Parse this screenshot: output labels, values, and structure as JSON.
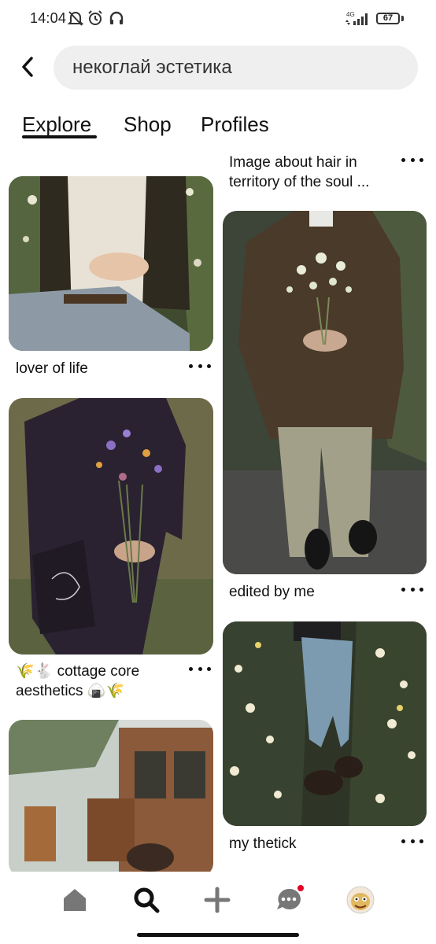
{
  "status": {
    "time": "14:04",
    "network": "4G",
    "battery": "67"
  },
  "search": {
    "query": "некоглай эстетика"
  },
  "tabs": [
    "Explore",
    "Shop",
    "Profiles"
  ],
  "pins": {
    "left": [
      {
        "title": "lover of life"
      },
      {
        "title": "🌾🐇 cottage core aesthetics 🍙🌾",
        "title_line1": "🌾🐇 cottage core",
        "title_line2": "aesthetics 🍙🌾"
      },
      {
        "title": ""
      }
    ],
    "right": [
      {
        "title_line1": "Image about hair in",
        "title_line2": "territory of the soul ..."
      },
      {
        "title": "edited by me"
      },
      {
        "title": "my thetick"
      }
    ]
  },
  "nav": {
    "items": [
      "home-icon",
      "search-icon",
      "add-icon",
      "messages-icon",
      "profile-avatar"
    ],
    "active": "search-icon",
    "notification_color": "#e60023"
  }
}
